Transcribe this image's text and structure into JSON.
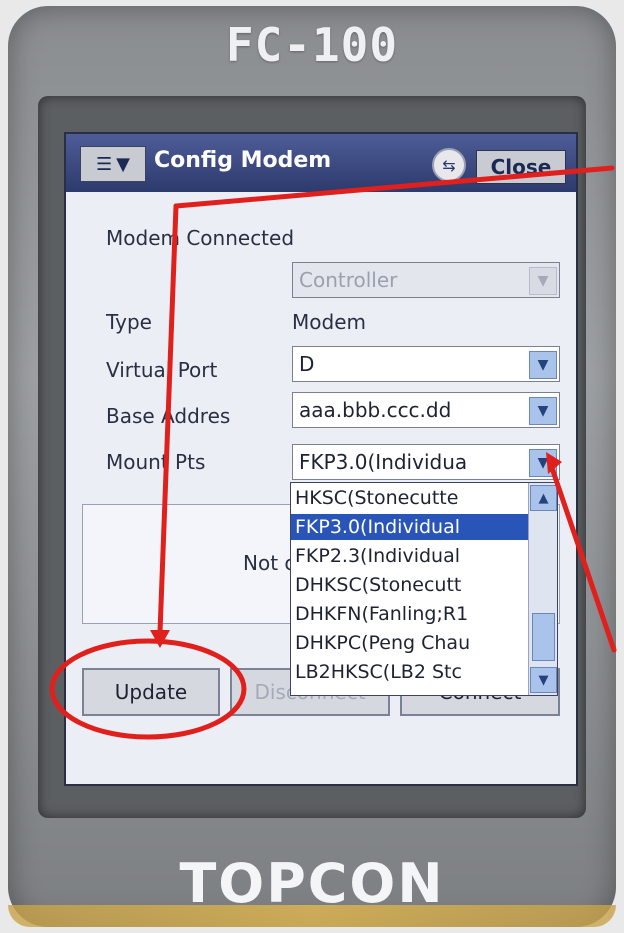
{
  "device": {
    "model": "FC-100",
    "brand": "TOPCON"
  },
  "window": {
    "title": "Config  Modem",
    "close_label": "Close"
  },
  "form": {
    "modem_status": "Modem Connected",
    "controller_value": "Controller",
    "type_label": "Type",
    "type_value": "Modem",
    "virtual_port_label": "Virtual Port",
    "virtual_port_value": "D",
    "base_address_label": "Base Addres",
    "base_address_value": "aaa.bbb.ccc.dd",
    "mount_pts_label": "Mount Pts",
    "mount_pts_value": "FKP3.0(Individua"
  },
  "mount_pts_options": [
    "HKSC(Stonecutte",
    "FKP3.0(Individual",
    "FKP2.3(Individual",
    "DHKSC(Stonecutt",
    "DHKFN(Fanling;R1",
    "DHKPC(Peng Chau",
    "LB2HKSC(LB2 Stc"
  ],
  "selected_index": 1,
  "status_text": "Not c",
  "buttons": {
    "update": "Update",
    "disconnect": "Disconnect",
    "connect": "Connect"
  },
  "colors": {
    "annotation": "#e0201c",
    "titlebar": "#2d3a6d",
    "selection": "#2a55b8"
  }
}
